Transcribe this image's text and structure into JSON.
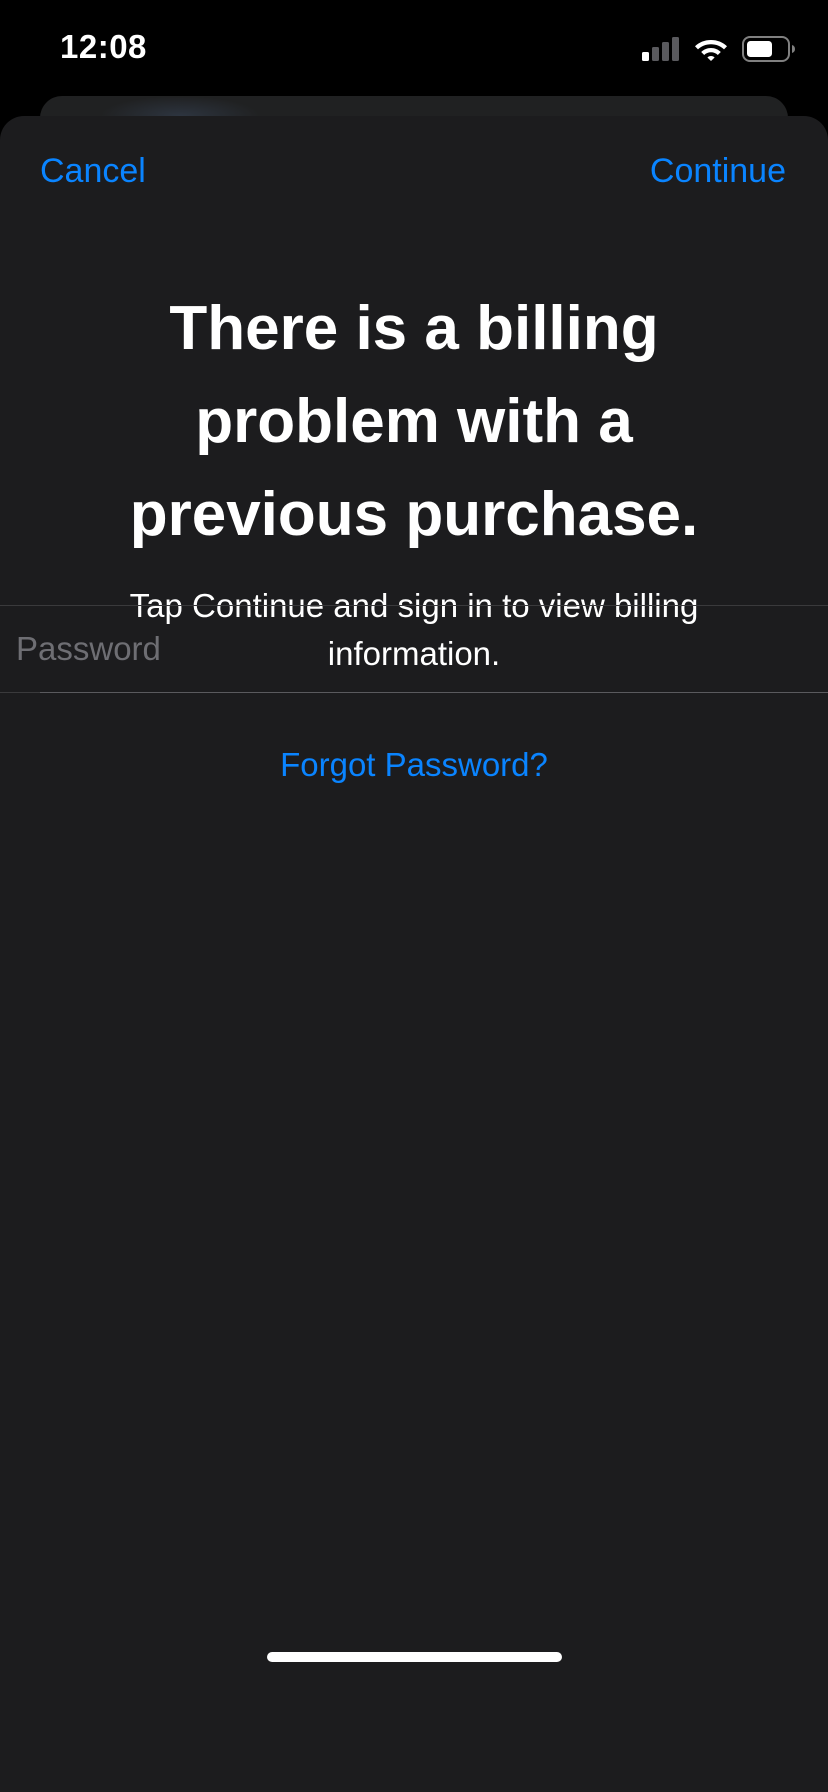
{
  "status_bar": {
    "time": "12:08",
    "signal_icon": "cellular-signal-icon",
    "wifi_icon": "wifi-icon",
    "battery_icon": "battery-icon"
  },
  "nav": {
    "cancel_label": "Cancel",
    "continue_label": "Continue"
  },
  "content": {
    "title": "There is a billing problem with a previous purchase.",
    "subtitle": "Tap Continue and sign in to view billing information."
  },
  "password": {
    "value": "",
    "placeholder": "Password"
  },
  "forgot_password_label": "Forgot Password?",
  "colors": {
    "accent": "#0a84ff",
    "sheet_background": "#1c1c1e",
    "status_bar_background": "#000000"
  }
}
